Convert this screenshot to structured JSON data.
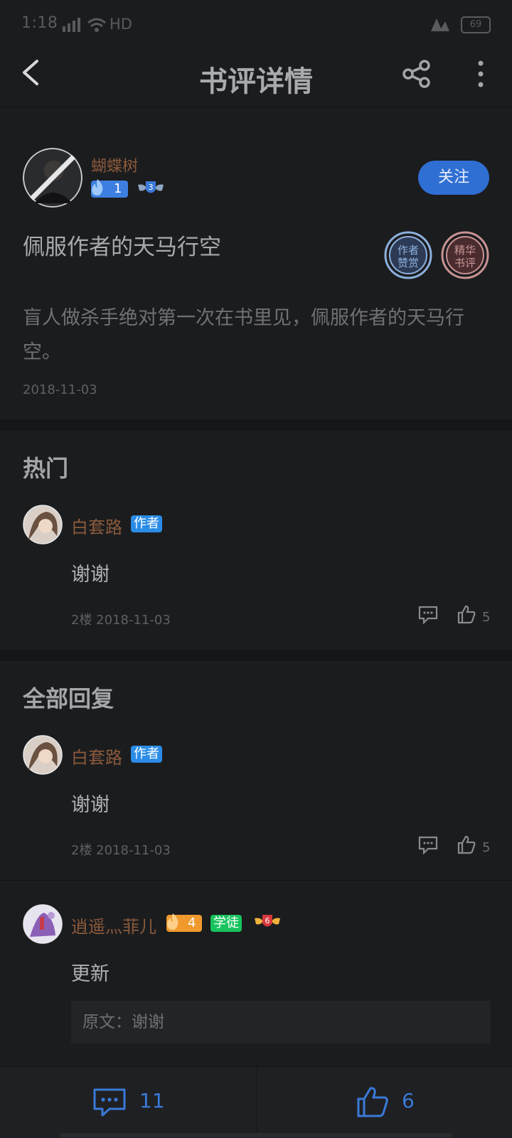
{
  "status": {
    "time": "1:18",
    "network": "HD",
    "battery": "69"
  },
  "header": {
    "title": "书评详情"
  },
  "review": {
    "author": "蝴蝶树",
    "fan_level": "1",
    "rank_level": "3",
    "follow_label": "关注",
    "title": "佩服作者的天马行空",
    "stamp_1": "作者",
    "stamp_1b": "赞赏",
    "stamp_2": "精华",
    "stamp_2b": "书评",
    "body": "盲人做杀手绝对第一次在书里见，佩服作者的天马行空。",
    "date": "2018-11-03"
  },
  "hot": {
    "section_title": "热门",
    "reply": {
      "name": "白套路",
      "badge": "作者",
      "text": "谢谢",
      "meta": "2楼 2018-11-03",
      "likes": "5"
    }
  },
  "all": {
    "section_title": "全部回复",
    "reply1": {
      "name": "白套路",
      "badge": "作者",
      "text": "谢谢",
      "meta": "2楼 2018-11-03",
      "likes": "5"
    },
    "reply2": {
      "name": "逍遥灬菲儿",
      "fan_level": "4",
      "badge": "学徒",
      "rank_level": "6",
      "text": "更新",
      "quote": "原文：谢谢"
    }
  },
  "bottom": {
    "comments": "11",
    "likes": "6"
  },
  "colors": {
    "accent": "#2f6fd3",
    "username": "#8b5a3c",
    "author_badge": "#2a8ce6",
    "apprentice_badge": "#17c35d"
  }
}
